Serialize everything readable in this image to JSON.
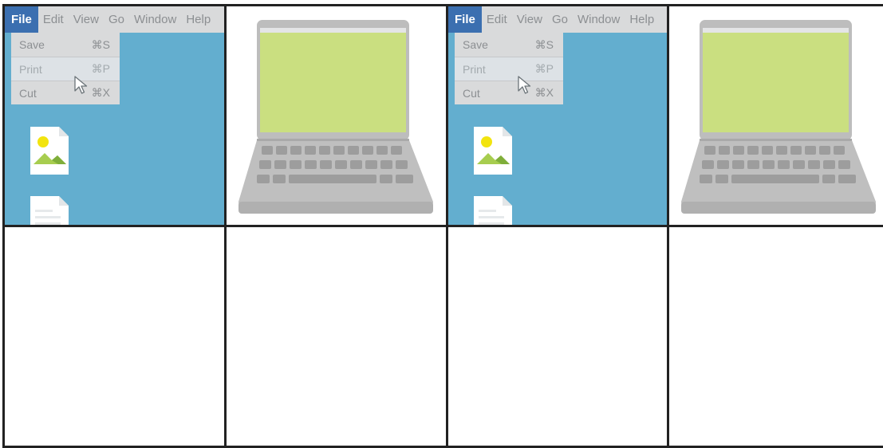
{
  "menu_bar": {
    "items": [
      "File",
      "Edit",
      "View",
      "Go",
      "Window",
      "Help"
    ],
    "active": "File"
  },
  "file_menu": {
    "items": [
      {
        "label": "Save",
        "shortcut": "⌘S"
      },
      {
        "label": "Print",
        "shortcut": "⌘P"
      },
      {
        "label": "Cut",
        "shortcut": "⌘X"
      }
    ],
    "highlighted": "Print"
  },
  "colors": {
    "desktop_bg": "#63aecf",
    "menu_bg": "#d9dadb",
    "active_menu": "#3b6fb0",
    "laptop_screen": "#cadf80",
    "laptop_body": "#bfbfbf",
    "grid_line": "#222222"
  },
  "icons": [
    "image-file-icon",
    "document-file-icon",
    "pointer-cursor-icon",
    "laptop-icon"
  ]
}
